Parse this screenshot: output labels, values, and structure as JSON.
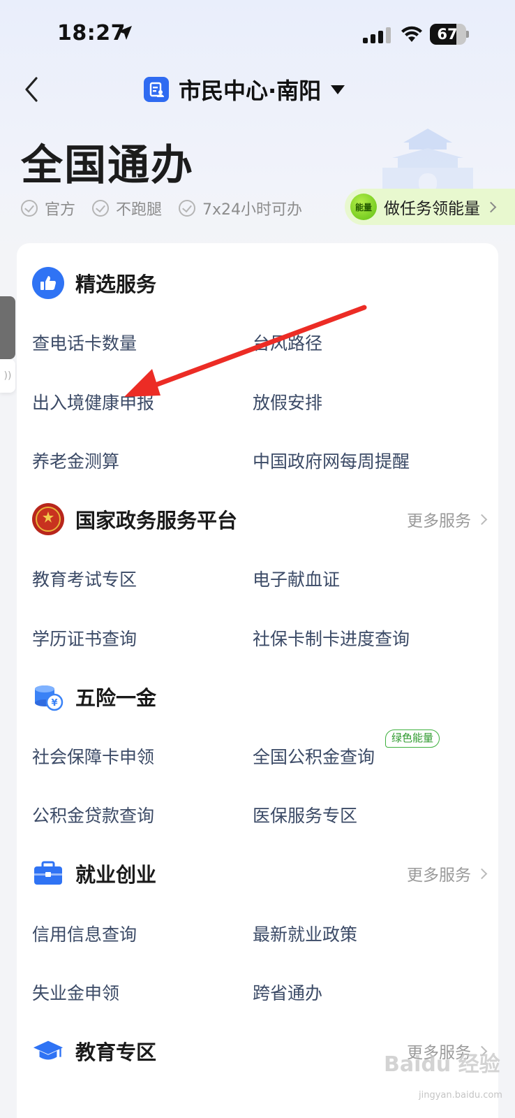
{
  "status": {
    "time": "18:27",
    "battery": "67"
  },
  "nav": {
    "title": "市民中心·南阳"
  },
  "header": {
    "title": "全国通办",
    "tags": [
      "官方",
      "不跑腿",
      "7x24小时可办"
    ],
    "task_badge": "能量",
    "task_text": "做任务领能量"
  },
  "sections": [
    {
      "title": "精选服务",
      "more": "",
      "items": [
        "查电话卡数量",
        "台风路径",
        "出入境健康申报",
        "放假安排",
        "养老金测算",
        "中国政府网每周提醒"
      ]
    },
    {
      "title": "国家政务服务平台",
      "more": "更多服务",
      "items": [
        "教育考试专区",
        "电子献血证",
        "学历证书查询",
        "社保卡制卡进度查询"
      ]
    },
    {
      "title": "五险一金",
      "more": "",
      "items": [
        "社会保障卡申领",
        "全国公积金查询",
        "公积金贷款查询",
        "医保服务专区"
      ],
      "badge": "绿色能量"
    },
    {
      "title": "就业创业",
      "more": "更多服务",
      "items": [
        "信用信息查询",
        "最新就业政策",
        "失业金申领",
        "跨省通办"
      ]
    },
    {
      "title": "教育专区",
      "more": "更多服务",
      "items": []
    }
  ],
  "watermark": {
    "main": "Baidu 经验",
    "sub": "jingyan.baidu.com"
  },
  "colors": {
    "accent": "#2f6bf1",
    "green": "#3db03d",
    "annotation": "#ec2c25"
  }
}
